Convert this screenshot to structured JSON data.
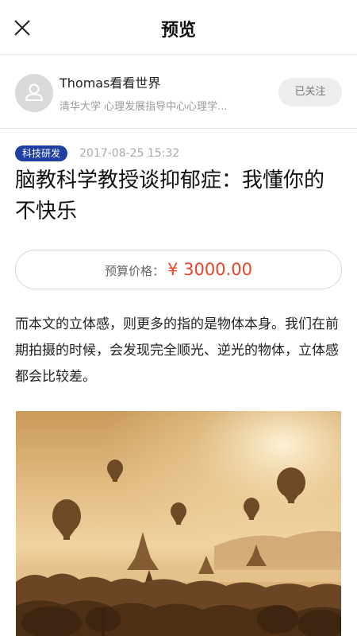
{
  "navbar": {
    "title": "预览"
  },
  "author": {
    "name": "Thomas看看世界",
    "description": "清华大学 心理发展指导中心心理学...",
    "follow_label": "已关注"
  },
  "article": {
    "tag": "科技研发",
    "date": "2017-08-25 15:32",
    "title": "脑教科学教授谈抑郁症：我懂你的不快乐",
    "budget_label": "预算价格：",
    "budget_value": "¥ 3000.00",
    "body": "而本文的立体感，则更多的指的是物体本身。我们在前期拍摄的时候，会发现完全顺光、逆光的物体，立体感都会比较差。"
  },
  "colors": {
    "accent": "#1f3fa3",
    "price": "#e8452b",
    "follow_bg": "#ededed"
  }
}
